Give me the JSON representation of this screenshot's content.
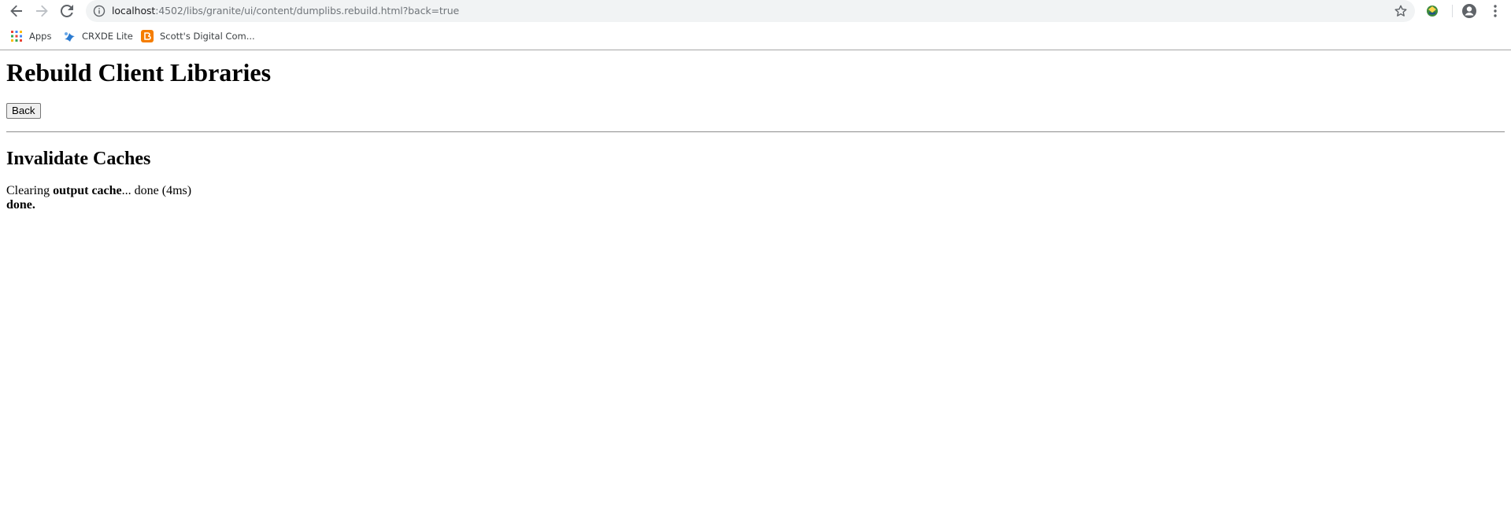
{
  "browser": {
    "url_host": "localhost",
    "url_rest": ":4502/libs/granite/ui/content/dumplibs.rebuild.html?back=true",
    "bookmarks": [
      {
        "label": "Apps",
        "icon": "apps-grid-icon"
      },
      {
        "label": "CRXDE Lite",
        "icon": "crxde-icon"
      },
      {
        "label": "Scott's Digital Com...",
        "icon": "blogger-icon"
      }
    ],
    "colors": {
      "omnibox_bg": "#f1f3f4",
      "icon": "#5f6368",
      "blogger": "#f57d00"
    }
  },
  "page": {
    "title": "Rebuild Client Libraries",
    "back_button": "Back",
    "section_title": "Invalidate Caches",
    "log": {
      "prefix": "Clearing ",
      "bold_term": "output cache",
      "suffix": "... done (4ms)",
      "final": "done."
    }
  }
}
